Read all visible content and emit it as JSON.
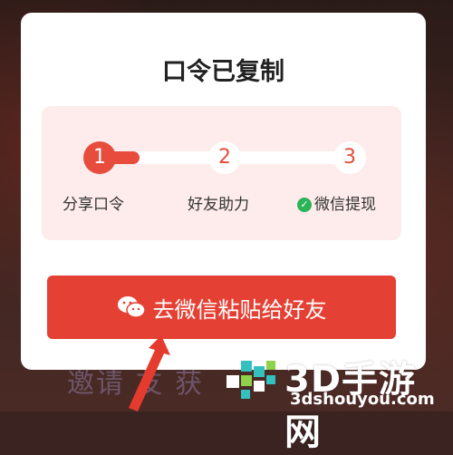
{
  "dialog": {
    "title": "口令已复制"
  },
  "steps": [
    {
      "number": "1",
      "label": "分享口令",
      "state": "active"
    },
    {
      "number": "2",
      "label": "好友助力",
      "state": "inactive"
    },
    {
      "number": "3",
      "label": "微信提现",
      "state": "inactive",
      "icon": "wechat-pay-icon"
    }
  ],
  "progress": {
    "completed_steps": 1,
    "total_steps": 3
  },
  "cta": {
    "label": "去微信粘贴给好友",
    "icon": "wechat-icon"
  },
  "background": {
    "partial_text": "邀请  友 获"
  },
  "watermark": {
    "brand": "3D手游网",
    "url": "3dshouyou.com"
  },
  "colors": {
    "accent": "#e54034",
    "panel": "#fdeceb",
    "wechat_green": "#2ab457"
  }
}
